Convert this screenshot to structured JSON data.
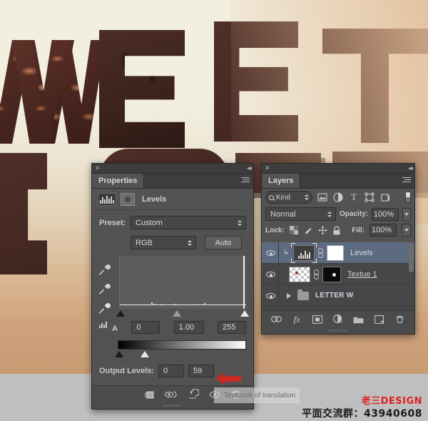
{
  "artwork": {
    "letters": [
      "W",
      "E",
      "E",
      "T",
      "I"
    ],
    "alt": "chocolate-letters-artwork"
  },
  "properties_panel": {
    "tab_label": "Properties",
    "close_icon": "close-icon",
    "collapse_icon": "collapse-panel-icon",
    "menu_icon": "panel-menu-icon",
    "adjustment_title": "Levels",
    "levels_icon": "levels-histogram-icon",
    "clip_icon": "clip-to-layer-icon",
    "preset_label": "Preset:",
    "preset_value": "Custom",
    "channel_value": "RGB",
    "auto_label": "Auto",
    "eyedroppers": [
      "black-point-eyedropper",
      "gray-point-eyedropper",
      "white-point-eyedropper"
    ],
    "input_shadow": "0",
    "input_midtone": "1.00",
    "input_highlight": "255",
    "auto_options_icon": "auto-options-icon",
    "output_label": "Output Levels:",
    "output_black": "0",
    "output_white": "59",
    "footer_icons": [
      "clip-to-layer-button",
      "view-previous-state-button",
      "reset-adjustment-button",
      "toggle-visibility-button",
      "delete-adjustment-button"
    ]
  },
  "layers_panel": {
    "tab_label": "Layers",
    "close_icon": "close-icon",
    "collapse_icon": "collapse-panel-icon",
    "menu_icon": "panel-menu-icon",
    "filter_kind_label": "Kind",
    "filter_icons": [
      "filter-pixel-layers-icon",
      "filter-adjustment-layers-icon",
      "filter-type-layers-icon",
      "filter-shape-layers-icon",
      "filter-smart-object-icon"
    ],
    "filter_toggle_icon": "filter-enable-toggle",
    "blend_mode": "Normal",
    "opacity_label": "Opacity:",
    "opacity_value": "100%",
    "lock_label": "Lock:",
    "lock_icons": [
      "lock-transparent-pixels-icon",
      "lock-image-pixels-icon",
      "lock-position-icon",
      "lock-all-icon"
    ],
    "fill_label": "Fill:",
    "fill_value": "100%",
    "layers": [
      {
        "name": "Levels",
        "type": "adjustment",
        "selected": true,
        "visible": true,
        "editing": false,
        "thumb": "levels-adjustment-thumbnail",
        "mask_thumb": "white-layer-mask-thumbnail",
        "clipped": true
      },
      {
        "name": "Textue 1",
        "type": "pixel",
        "selected": false,
        "visible": true,
        "editing": true,
        "thumb": "texture-layer-thumbnail",
        "mask_thumb": "black-layer-mask-thumbnail",
        "clipped": false
      },
      {
        "name": "LETTER W",
        "type": "group",
        "selected": false,
        "visible": true,
        "editing": false,
        "collapsed": true
      }
    ],
    "footer_icons": [
      "link-layers-icon",
      "add-layer-style-icon",
      "add-layer-mask-icon",
      "new-adjustment-layer-icon",
      "new-group-icon",
      "new-layer-icon",
      "delete-layer-icon"
    ]
  },
  "annotations": {
    "arrow_color": "#c92a22",
    "arrow_name": "red-pointer-arrow",
    "translate_overlay": "Textbook of translation"
  },
  "watermark": {
    "brand": "老三DESIGN",
    "brand_color": "#e02020",
    "qq_group": "平面交流群：43940608"
  }
}
